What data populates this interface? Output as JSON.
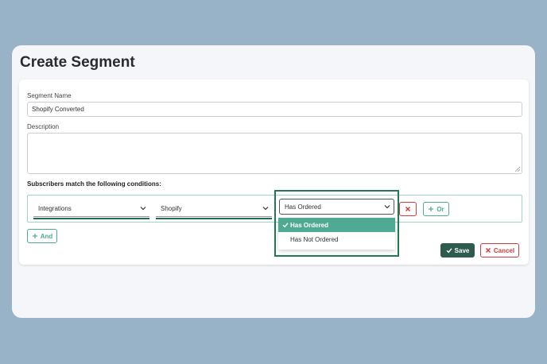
{
  "page": {
    "title": "Create Segment"
  },
  "form": {
    "segment_name_label": "Segment Name",
    "segment_name_value": "Shopify Converted",
    "description_label": "Description",
    "description_value": "",
    "conditions_label": "Subscribers match the following conditions:"
  },
  "condition": {
    "field1_value": "Integrations",
    "field2_value": "Shopify",
    "field3_value": "Has Ordered",
    "options": [
      "Has Ordered",
      "Has Not Ordered"
    ],
    "selected_option": "Has Ordered"
  },
  "buttons": {
    "remove_icon": "close-icon",
    "or_label": "Or",
    "and_label": "And",
    "save_label": "Save",
    "cancel_label": "Cancel"
  },
  "colors": {
    "accent_teal": "#4fa993",
    "save_green": "#2f5a4e",
    "danger_red": "#d23b3b",
    "highlight_green": "#1f7a52"
  }
}
